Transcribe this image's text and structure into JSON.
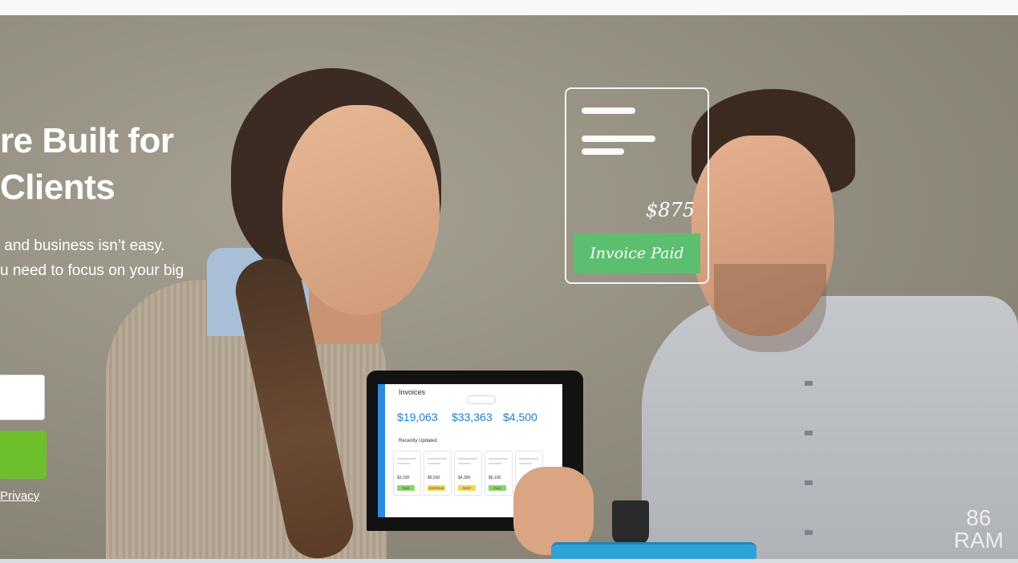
{
  "hero": {
    "headline_line1": "re Built for",
    "headline_line2": "Clients",
    "subtext_line1": " and business isn’t easy.",
    "subtext_line2": "u need to focus on your big",
    "privacy_link": "Privacy"
  },
  "invoice_card": {
    "amount": "$875",
    "status": "Invoice Paid"
  },
  "laptop_screen": {
    "title": "Invoices",
    "amounts": [
      "$19,063",
      "$33,363",
      "$4,500"
    ],
    "section_title": "Recently Updated",
    "cards": [
      {
        "value": "$3,330",
        "tag": "PAID"
      },
      {
        "value": "$9,500",
        "tag": "OVERDUE"
      },
      {
        "value": "$4,300",
        "tag": "SENT"
      },
      {
        "value": "$6,100",
        "tag": "PAID"
      },
      {
        "value": "",
        "tag": ""
      }
    ]
  },
  "watermark": {
    "line1": "86",
    "line2": "RAM"
  },
  "colors": {
    "cta_green": "#6cbf2a",
    "invoice_paid_green": "#5cbf6f",
    "screen_accent_blue": "#1b7fcf"
  }
}
